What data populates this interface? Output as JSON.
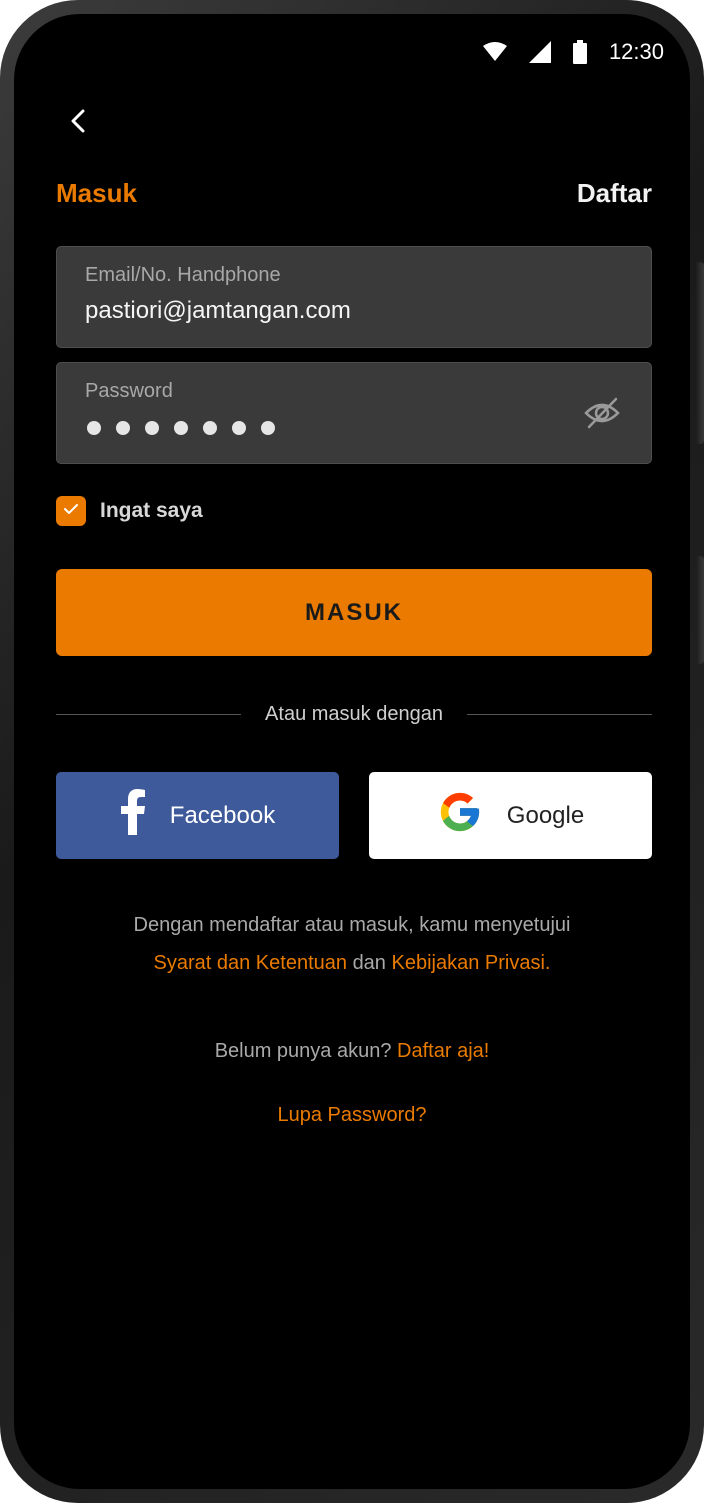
{
  "status_bar": {
    "time": "12:30"
  },
  "tabs": {
    "login": "Masuk",
    "register": "Daftar"
  },
  "form": {
    "email_label": "Email/No. Handphone",
    "email_value": "pastiori@jamtangan.com",
    "password_label": "Password",
    "password_length": 7,
    "remember_label": "Ingat saya",
    "remember_checked": true,
    "submit_label": "MASUK"
  },
  "divider_text": "Atau masuk dengan",
  "social": {
    "facebook_label": "Facebook",
    "google_label": "Google"
  },
  "terms": {
    "prefix": "Dengan mendaftar atau masuk, kamu menyetujui",
    "terms_link": "Syarat dan Ketentuan",
    "conjunction": "dan",
    "privacy_link": "Kebijakan Privasi."
  },
  "signup": {
    "prompt": "Belum punya akun?",
    "link": "Daftar aja!"
  },
  "forgot_password": "Lupa Password?",
  "colors": {
    "accent": "#ea7b00",
    "facebook": "#3f5a9b",
    "field_bg": "#3a3a3a",
    "background": "#000000"
  },
  "icons": [
    "wifi-icon",
    "signal-icon",
    "battery-icon",
    "back-chevron-icon",
    "eye-off-icon",
    "check-icon",
    "facebook-icon",
    "google-icon"
  ]
}
